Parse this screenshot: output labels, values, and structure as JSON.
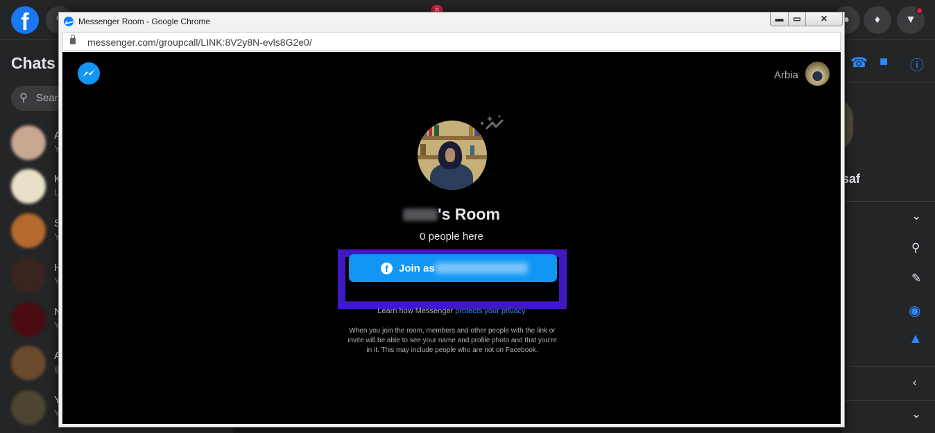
{
  "background": {
    "sidebar_title": "Chats",
    "search_placeholder": "Search Messenger",
    "notification_count": "8",
    "chat_initials": [
      "A",
      "K",
      "S",
      "H",
      "N",
      "A",
      "Y"
    ],
    "chat_subs": [
      "Y",
      "L",
      "Y",
      "Y",
      "Y",
      "@",
      "Y"
    ],
    "right_name_fragment": "saf"
  },
  "browser": {
    "window_title": "Messenger Room - Google Chrome",
    "url": "messenger.com/groupcall/LINK:8V2y8N-evls8G2e0/",
    "minimize_glyph": "▬",
    "maximize_glyph": "▭",
    "close_glyph": "✕"
  },
  "room": {
    "user_name": "Arbia",
    "title_suffix": "'s Room",
    "people_here": "0 people here",
    "join_prefix": "Join as",
    "learn_prefix": "Learn how Messenger",
    "learn_link": "protects your privacy",
    "disclaimer": "When you join the room, members and other people with the link or invite will be able to see your name and profile photo and that you're in it. This may include people who are not on Facebook."
  },
  "colors": {
    "messenger_blue": "#1196f5",
    "highlight_purple": "#3f1ac4",
    "fb_dark": "#242526"
  }
}
